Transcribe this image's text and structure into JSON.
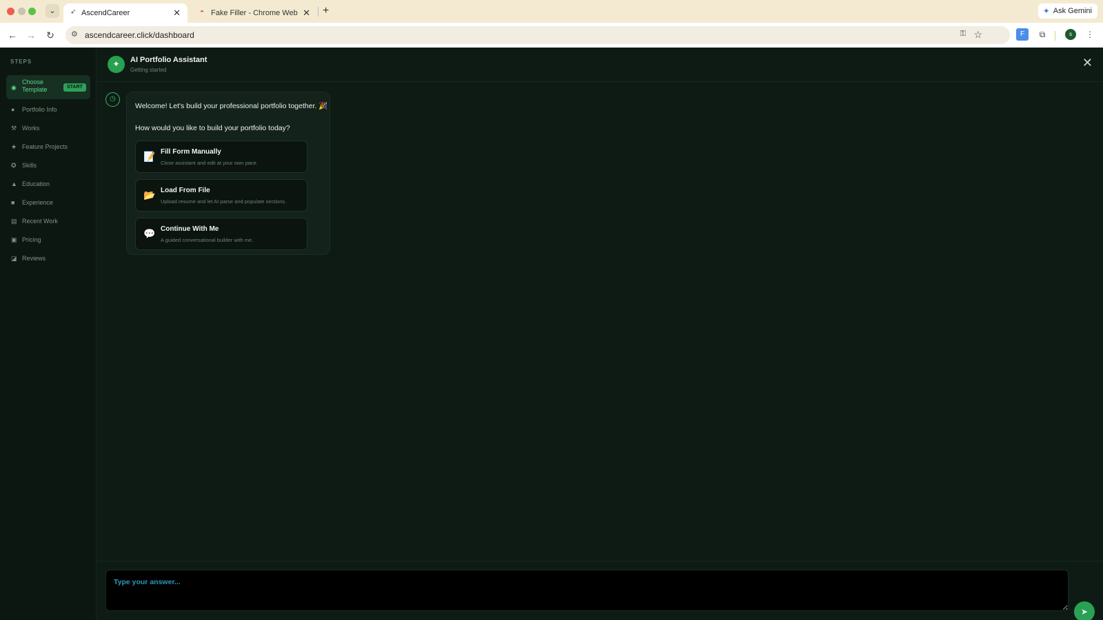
{
  "browser": {
    "tabs": [
      {
        "title": "AscendCareer",
        "active": true
      },
      {
        "title": "Fake Filler - Chrome Web Store",
        "active": false
      }
    ],
    "url": "ascendcareer.click/dashboard",
    "ask_gemini": "Ask Gemini",
    "profile_initial": "s"
  },
  "sidebar": {
    "heading": "STEPS",
    "items": [
      {
        "label": "Choose Template",
        "icon": "palette-icon",
        "active": true,
        "badge": "START"
      },
      {
        "label": "Portfolio Info",
        "icon": "user-icon"
      },
      {
        "label": "Works",
        "icon": "wrench-icon"
      },
      {
        "label": "Feature Projects",
        "icon": "star-icon"
      },
      {
        "label": "Skills",
        "icon": "bulb-icon"
      },
      {
        "label": "Education",
        "icon": "graduation-cap-icon"
      },
      {
        "label": "Experience",
        "icon": "briefcase-icon"
      },
      {
        "label": "Recent Work",
        "icon": "book-icon"
      },
      {
        "label": "Pricing",
        "icon": "money-icon"
      },
      {
        "label": "Reviews",
        "icon": "comment-icon"
      }
    ]
  },
  "header": {
    "title": "AI Portfolio Assistant",
    "subtitle": "Getting started"
  },
  "chat": {
    "welcome": "Welcome! Let's build your professional portfolio together. 🎉",
    "question": "How would you like to build your portfolio today?",
    "options": [
      {
        "title": "Fill Form Manually",
        "desc": "Close assistant and edit at your own pace.",
        "icon": "memo-icon"
      },
      {
        "title": "Load From File",
        "desc": "Upload resume and let AI parse and populate sections.",
        "icon": "folder-icon"
      },
      {
        "title": "Continue With Me",
        "desc": "A guided conversational builder with me.",
        "icon": "speech-bubble-icon"
      }
    ]
  },
  "composer": {
    "placeholder": "Type your answer..."
  },
  "colors": {
    "accent": "#2aa055",
    "background": "#0e1b14",
    "placeholder": "#2f97b8"
  }
}
